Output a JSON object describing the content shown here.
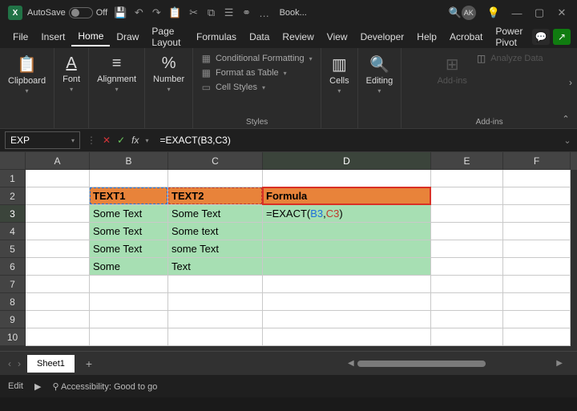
{
  "titlebar": {
    "autosave_label": "AutoSave",
    "autosave_state": "Off",
    "doc_title": "Book...",
    "avatar_initials": "AK"
  },
  "menu": {
    "items": [
      "File",
      "Insert",
      "Home",
      "Draw",
      "Page Layout",
      "Formulas",
      "Data",
      "Review",
      "View",
      "Developer",
      "Help",
      "Acrobat",
      "Power Pivot"
    ],
    "active_index": 2
  },
  "ribbon": {
    "clipboard": "Clipboard",
    "font": "Font",
    "alignment": "Alignment",
    "number": "Number",
    "cells": "Cells",
    "editing": "Editing",
    "addins": "Add-ins",
    "styles_label": "Styles",
    "addins_label": "Add-ins",
    "cond_fmt": "Conditional Formatting",
    "fmt_table": "Format as Table",
    "cell_styles": "Cell Styles",
    "analyze": "Analyze Data"
  },
  "fxbar": {
    "namebox": "EXP",
    "formula": "=EXACT(B3,C3)"
  },
  "grid": {
    "columns": [
      "A",
      "B",
      "C",
      "D",
      "E",
      "F"
    ],
    "rows": [
      "1",
      "2",
      "3",
      "4",
      "5",
      "6",
      "7",
      "8",
      "9",
      "10"
    ],
    "active_col": "D",
    "active_row": "3",
    "headers": {
      "b2": "TEXT1",
      "c2": "TEXT2",
      "d2": "Formula"
    },
    "data": {
      "b3": "Some Text",
      "c3": "Some Text",
      "b4": "Some Text",
      "c4": "Some text",
      "b5": "Some Text",
      "c5": "some Text",
      "b6": "Some",
      "c6": "Text"
    },
    "formula_cell_display_prefix": "=EXACT(",
    "formula_cell_ref1": "B3",
    "formula_cell_sep": ",",
    "formula_cell_ref2": "C3",
    "formula_cell_suffix": ")"
  },
  "sheettabs": {
    "active": "Sheet1"
  },
  "statusbar": {
    "mode": "Edit",
    "accessibility": "Accessibility: Good to go"
  }
}
